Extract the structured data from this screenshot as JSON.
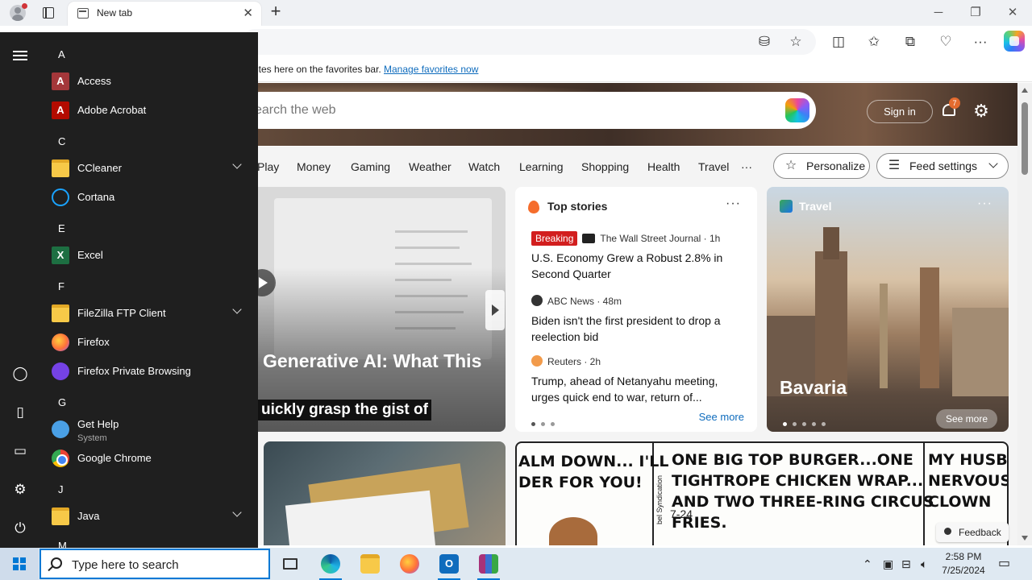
{
  "browser": {
    "tab_title": "New tab",
    "tab_close": "✕",
    "new_tab": "+",
    "window_controls": {
      "minimize": "─",
      "restore": "❐",
      "close": "✕"
    }
  },
  "favorites_bar": {
    "text": "ites here on the favorites bar.",
    "link": "Manage favorites now"
  },
  "page": {
    "search_placeholder": "earch the web",
    "sign_in": "Sign in",
    "notification_count": "7",
    "categories": [
      "Play",
      "Money",
      "Gaming",
      "Weather",
      "Watch",
      "Learning",
      "Shopping",
      "Health",
      "Travel",
      "···"
    ],
    "personalize": "Personalize",
    "feed_settings": "Feed settings"
  },
  "video_card": {
    "headline": "Generative AI: What This",
    "caption": "uickly grasp the gist of"
  },
  "top_stories": {
    "header": "Top stories",
    "more": "···",
    "stories": [
      {
        "badge": "Breaking",
        "source": "The Wall Street Journal · 1h",
        "title": "U.S. Economy Grew a Robust 2.8% in Second Quarter"
      },
      {
        "source": "ABC News · 48m",
        "title": "Biden isn't the first president to drop a reelection bid"
      },
      {
        "source": "Reuters · 2h",
        "title": "Trump, ahead of Netanyahu meeting, urges quick end to war, return of..."
      }
    ],
    "see_more": "See more"
  },
  "travel_card": {
    "header": "Travel",
    "more": "···",
    "place": "Bavaria",
    "see_more": "See more"
  },
  "comic": {
    "panel1": "ALM DOWN... I'LL\nDER FOR YOU!",
    "panel2": "ONE BIG TOP BURGER...ONE\nTIGHTROPE CHICKEN WRAP...\nAND TWO THREE-RING CIRCUS\nFRIES.",
    "panel3": "MY HUSBAN\nNERVOUS\nCLOWN",
    "syndication": "bel Syndication",
    "date": "7-24"
  },
  "feedback": "Feedback",
  "start_menu": {
    "sections": [
      {
        "letter": "A",
        "apps": [
          {
            "label": "Access",
            "icon": "access-icon"
          },
          {
            "label": "Adobe Acrobat",
            "icon": "acrobat-icon"
          }
        ]
      },
      {
        "letter": "C",
        "apps": [
          {
            "label": "CCleaner",
            "icon": "folder-icon"
          },
          {
            "label": "Cortana",
            "icon": "cortana-icon"
          }
        ]
      },
      {
        "letter": "E",
        "apps": [
          {
            "label": "Excel",
            "icon": "excel-icon"
          }
        ]
      },
      {
        "letter": "F",
        "apps": [
          {
            "label": "FileZilla FTP Client",
            "icon": "folder-icon"
          },
          {
            "label": "Firefox",
            "icon": "firefox-icon"
          },
          {
            "label": "Firefox Private Browsing",
            "icon": "firefox-private-icon"
          }
        ]
      },
      {
        "letter": "G",
        "apps": [
          {
            "label": "Get Help",
            "sub": "System",
            "icon": "help-icon"
          },
          {
            "label": "Google Chrome",
            "icon": "chrome-icon"
          }
        ]
      },
      {
        "letter": "J",
        "apps": [
          {
            "label": "Java",
            "icon": "folder-icon"
          }
        ]
      },
      {
        "letter": "M",
        "apps": []
      }
    ]
  },
  "taskbar": {
    "search_placeholder": "Type here to search",
    "time": "2:58 PM",
    "date": "7/25/2024"
  }
}
